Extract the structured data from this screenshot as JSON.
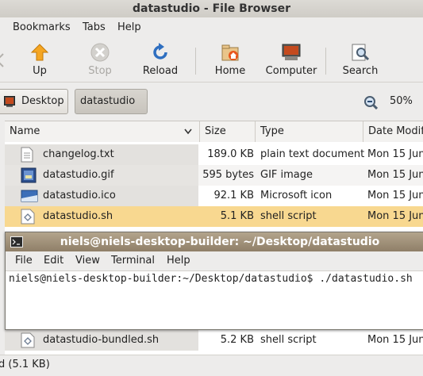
{
  "window": {
    "title": "datastudio - File Browser"
  },
  "menubar": [
    {
      "label": "Bookmarks",
      "key": "B"
    },
    {
      "label": "Tabs",
      "key": "T"
    },
    {
      "label": "Help",
      "key": "H"
    }
  ],
  "toolbar": {
    "up": "Up",
    "stop": "Stop",
    "reload": "Reload",
    "home": "Home",
    "computer": "Computer",
    "search": "Search"
  },
  "location": {
    "crumb_desktop": "Desktop",
    "crumb_current": "datastudio",
    "zoom": "50%"
  },
  "list": {
    "columns": {
      "name": "Name",
      "size": "Size",
      "type": "Type",
      "date": "Date Modif"
    },
    "rows": [
      {
        "name": "changelog.txt",
        "size": "189.0 KB",
        "type": "plain text document",
        "date": "Mon 15 Jun"
      },
      {
        "name": "datastudio.gif",
        "size": "595 bytes",
        "type": "GIF image",
        "date": "Mon 15 Jun"
      },
      {
        "name": "datastudio.ico",
        "size": "92.1 KB",
        "type": "Microsoft icon",
        "date": "Mon 15 Jun"
      },
      {
        "name": "datastudio.sh",
        "size": "5.1 KB",
        "type": "shell script",
        "date": "Mon 15 Jun"
      },
      {
        "name": "datastudio-bundled.sh",
        "size": "5.2 KB",
        "type": "shell script",
        "date": "Mon 15 Jun"
      }
    ]
  },
  "terminal": {
    "title": "niels@niels-desktop-builder: ~/Desktop/datastudio",
    "menu": [
      {
        "label": "File"
      },
      {
        "label": "Edit"
      },
      {
        "label": "View"
      },
      {
        "label": "Terminal"
      },
      {
        "label": "Help"
      }
    ],
    "line": "niels@niels-desktop-builder:~/Desktop/datastudio$ ./datastudio.sh"
  },
  "status": {
    "text": "d (5.1 KB)"
  }
}
